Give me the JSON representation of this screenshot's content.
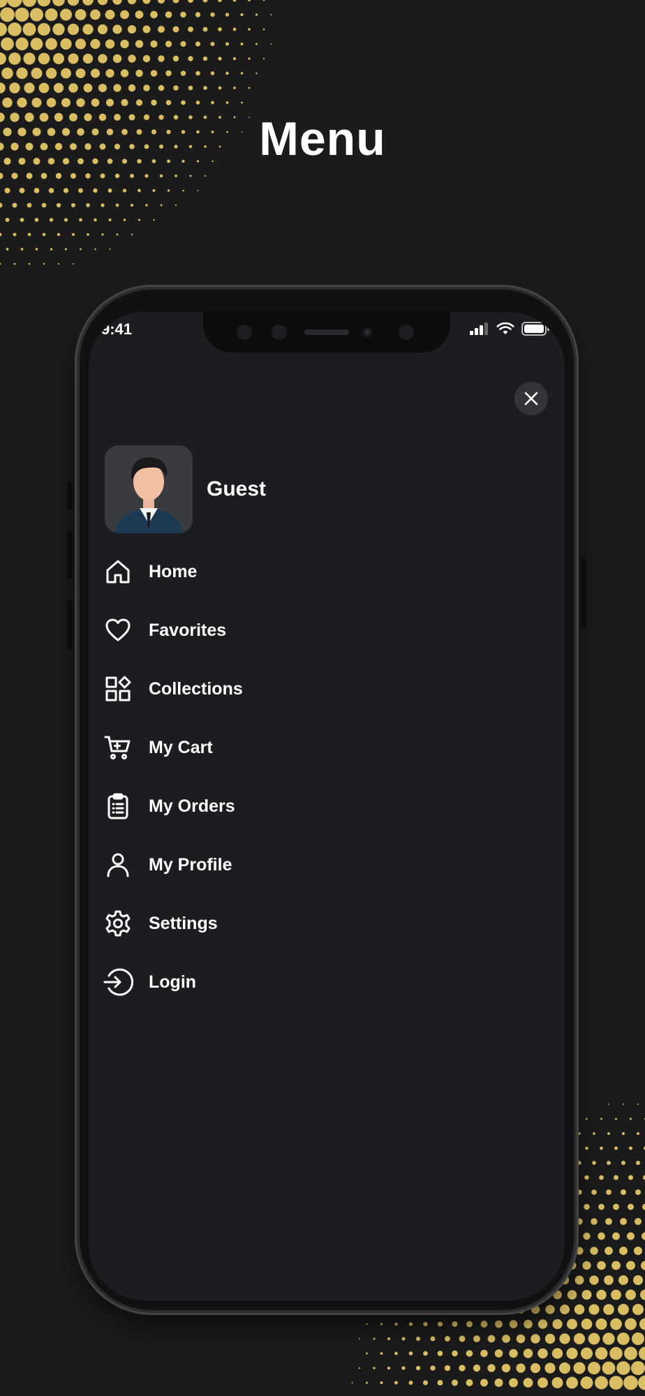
{
  "page": {
    "title": "Menu"
  },
  "status_bar": {
    "time": "9:41"
  },
  "drawer": {
    "user_name": "Guest",
    "items": [
      {
        "label": "Home",
        "icon": "home-icon"
      },
      {
        "label": "Favorites",
        "icon": "heart-icon"
      },
      {
        "label": "Collections",
        "icon": "collections-icon"
      },
      {
        "label": "My Cart",
        "icon": "cart-icon"
      },
      {
        "label": "My Orders",
        "icon": "clipboard-icon"
      },
      {
        "label": "My Profile",
        "icon": "user-icon"
      },
      {
        "label": "Settings",
        "icon": "gear-icon"
      },
      {
        "label": "Login",
        "icon": "login-icon"
      }
    ]
  },
  "colors": {
    "background": "#1b1b1b",
    "screen": "#1c1d21",
    "accent_gold": "#d8bd63",
    "text": "#ffffff"
  }
}
